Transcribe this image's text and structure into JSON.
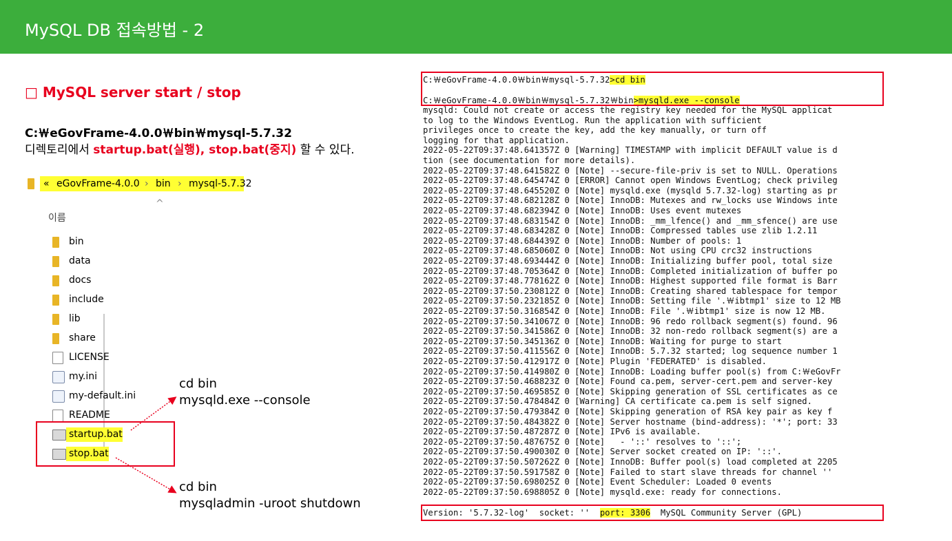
{
  "header": {
    "title": "MySQL DB 접속방법 - 2"
  },
  "section": {
    "heading": "□ MySQL server start / stop",
    "path": "C:￦eGovFrame-4.0.0￦bin￦mysql-5.7.32",
    "desc_prefix": "디렉토리에서 ",
    "desc_highlight": "startup.bat(실행), stop.bat(중지)",
    "desc_suffix": " 할 수 있다."
  },
  "explorer": {
    "breadcrumb": [
      "«",
      "eGovFrame-4.0.0",
      "›",
      "bin",
      "›",
      "mysql-5.7.32"
    ],
    "sort_caret": "^",
    "column_name": "이름",
    "items": [
      {
        "name": "bin",
        "icon": "folder-icon"
      },
      {
        "name": "data",
        "icon": "folder-icon"
      },
      {
        "name": "docs",
        "icon": "folder-icon"
      },
      {
        "name": "include",
        "icon": "folder-icon"
      },
      {
        "name": "lib",
        "icon": "folder-icon"
      },
      {
        "name": "share",
        "icon": "folder-icon"
      },
      {
        "name": "LICENSE",
        "icon": "document-icon"
      },
      {
        "name": "my.ini",
        "icon": "settings-file-icon"
      },
      {
        "name": "my-default.ini",
        "icon": "settings-file-icon"
      },
      {
        "name": "README",
        "icon": "document-icon"
      },
      {
        "name": "startup.bat",
        "icon": "batch-file-icon"
      },
      {
        "name": "stop.bat",
        "icon": "batch-file-icon"
      }
    ]
  },
  "annotations": {
    "start": {
      "line1": "cd bin",
      "line2": "mysqld.exe --console"
    },
    "stop": {
      "line1": "cd bin",
      "line2": "mysqladmin -uroot shutdown"
    }
  },
  "console": {
    "cmd1_prompt": "C:￦eGovFrame-4.0.0￦bin￦mysql-5.7.32",
    "cmd1_input": ">cd bin",
    "cmd2_prompt": "C:￦eGovFrame-4.0.0￦bin￦mysql-5.7.32￦bin",
    "cmd2_input": ">mysqld.exe --console",
    "lines": [
      "mysqld: Could not create or access the registry key needed for the MySQL applicat",
      "to log to the Windows EventLog. Run the application with sufficient",
      "privileges once to create the key, add the key manually, or turn off",
      "logging for that application.",
      "2022-05-22T09:37:48.641357Z 0 [Warning] TIMESTAMP with implicit DEFAULT value is d",
      "tion (see documentation for more details).",
      "2022-05-22T09:37:48.641582Z 0 [Note] --secure-file-priv is set to NULL. Operations",
      "2022-05-22T09:37:48.645474Z 0 [ERROR] Cannot open Windows EventLog; check privileg",
      "2022-05-22T09:37:48.645520Z 0 [Note] mysqld.exe (mysqld 5.7.32-log) starting as pr",
      "2022-05-22T09:37:48.682128Z 0 [Note] InnoDB: Mutexes and rw_locks use Windows inte",
      "2022-05-22T09:37:48.682394Z 0 [Note] InnoDB: Uses event mutexes",
      "2022-05-22T09:37:48.683154Z 0 [Note] InnoDB: _mm_lfence() and _mm_sfence() are use",
      "2022-05-22T09:37:48.683428Z 0 [Note] InnoDB: Compressed tables use zlib 1.2.11",
      "2022-05-22T09:37:48.684439Z 0 [Note] InnoDB: Number of pools: 1",
      "2022-05-22T09:37:48.685060Z 0 [Note] InnoDB: Not using CPU crc32 instructions",
      "2022-05-22T09:37:48.693444Z 0 [Note] InnoDB: Initializing buffer pool, total size",
      "2022-05-22T09:37:48.705364Z 0 [Note] InnoDB: Completed initialization of buffer po",
      "2022-05-22T09:37:48.778162Z 0 [Note] InnoDB: Highest supported file format is Barr",
      "2022-05-22T09:37:50.230812Z 0 [Note] InnoDB: Creating shared tablespace for tempor",
      "2022-05-22T09:37:50.232185Z 0 [Note] InnoDB: Setting file '.￦ibtmp1' size to 12 MB",
      "2022-05-22T09:37:50.316854Z 0 [Note] InnoDB: File '.￦ibtmp1' size is now 12 MB.",
      "2022-05-22T09:37:50.341067Z 0 [Note] InnoDB: 96 redo rollback segment(s) found. 96",
      "2022-05-22T09:37:50.341586Z 0 [Note] InnoDB: 32 non-redo rollback segment(s) are a",
      "2022-05-22T09:37:50.345136Z 0 [Note] InnoDB: Waiting for purge to start",
      "2022-05-22T09:37:50.411556Z 0 [Note] InnoDB: 5.7.32 started; log sequence number 1",
      "2022-05-22T09:37:50.412917Z 0 [Note] Plugin 'FEDERATED' is disabled.",
      "2022-05-22T09:37:50.414980Z 0 [Note] InnoDB: Loading buffer pool(s) from C:￦eGovFr",
      "2022-05-22T09:37:50.468823Z 0 [Note] Found ca.pem, server-cert.pem and server-key",
      "2022-05-22T09:37:50.469585Z 0 [Note] Skipping generation of SSL certificates as ce",
      "2022-05-22T09:37:50.478484Z 0 [Warning] CA certificate ca.pem is self signed.",
      "2022-05-22T09:37:50.479384Z 0 [Note] Skipping generation of RSA key pair as key f",
      "2022-05-22T09:37:50.484382Z 0 [Note] Server hostname (bind-address): '*'; port: 33",
      "2022-05-22T09:37:50.487287Z 0 [Note] IPv6 is available.",
      "2022-05-22T09:37:50.487675Z 0 [Note]   - '::' resolves to '::';",
      "2022-05-22T09:37:50.490030Z 0 [Note] Server socket created on IP: '::'.",
      "2022-05-22T09:37:50.507262Z 0 [Note] InnoDB: Buffer pool(s) load completed at 2205",
      "2022-05-22T09:37:50.591758Z 0 [Note] Failed to start slave threads for channel ''",
      "2022-05-22T09:37:50.698025Z 0 [Note] Event Scheduler: Loaded 0 events",
      "2022-05-22T09:37:50.698805Z 0 [Note] mysqld.exe: ready for connections."
    ],
    "version_prefix": "Version: '5.7.32-log'  socket: ''  ",
    "version_port": "port: 3306",
    "version_suffix": "  MySQL Community Server (GPL)"
  },
  "colors": {
    "header_bg": "#3cae3c",
    "accent_red": "#e8001e",
    "highlight": "#ffff33"
  }
}
